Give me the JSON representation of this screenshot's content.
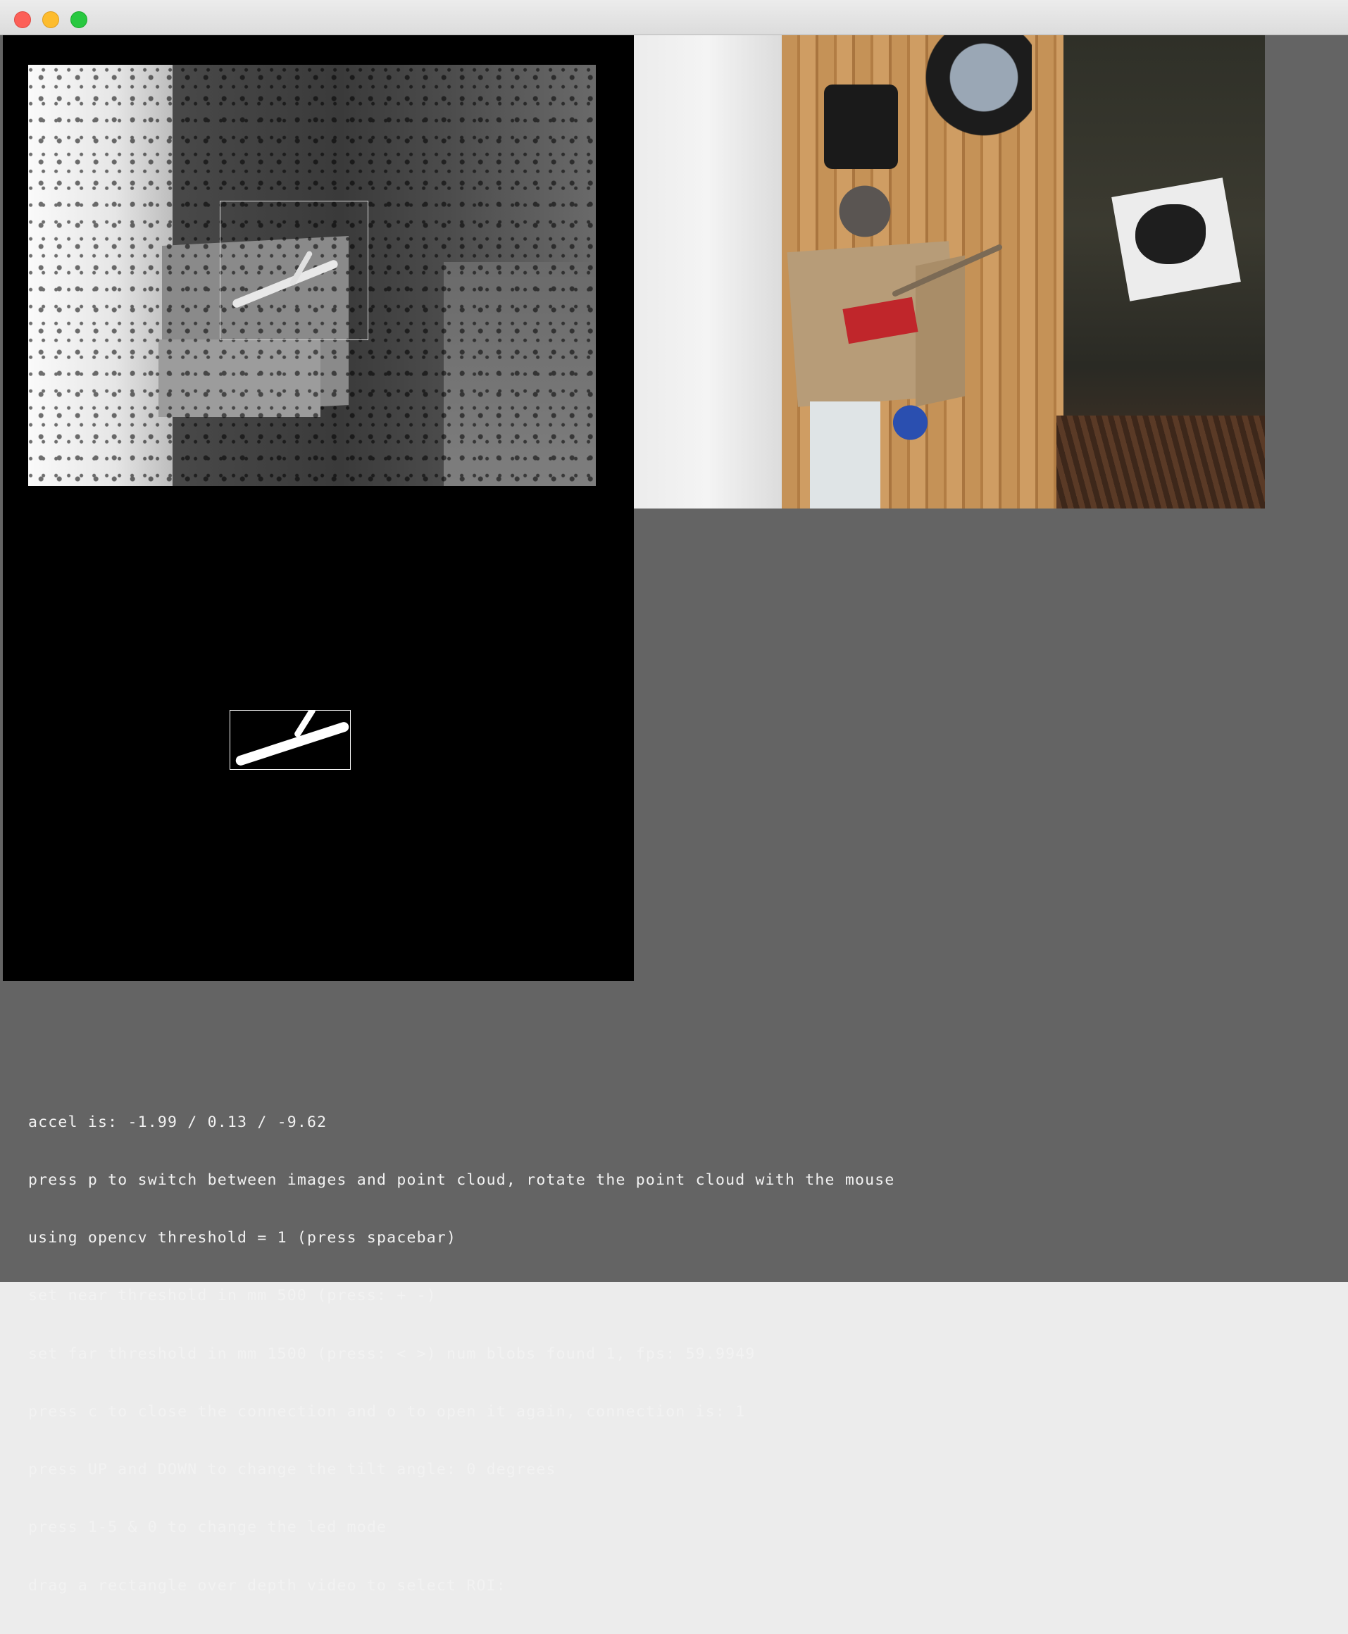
{
  "window": {
    "buttons": [
      "close",
      "minimize",
      "maximize"
    ]
  },
  "views": {
    "depth": {
      "icon": "depth-image",
      "roi_selected": true
    },
    "blobs": {
      "blob_count": 1
    },
    "rgb": {
      "icon": "camera-image"
    }
  },
  "status": {
    "lines": [
      "accel is: -1.99 / 0.13 / -9.62",
      "press p to switch between images and point cloud, rotate the point cloud with the mouse",
      "using opencv threshold = 1 (press spacebar)",
      "set near threshold in mm 500 (press: + -)",
      "set far threshold in mm 1500 (press: < >) num blobs found 1, fps: 59.9949",
      "press c to close the connection and o to open it again, connection is: 1",
      "press UP and DOWN to change the tilt angle: 0 degrees",
      "press 1-5 & 0 to change the led mode",
      "drag a rectangle over depth video to select ROI:"
    ]
  },
  "colors": {
    "background": "#646464",
    "text": "#f2f2f2",
    "pane_black": "#000000"
  }
}
